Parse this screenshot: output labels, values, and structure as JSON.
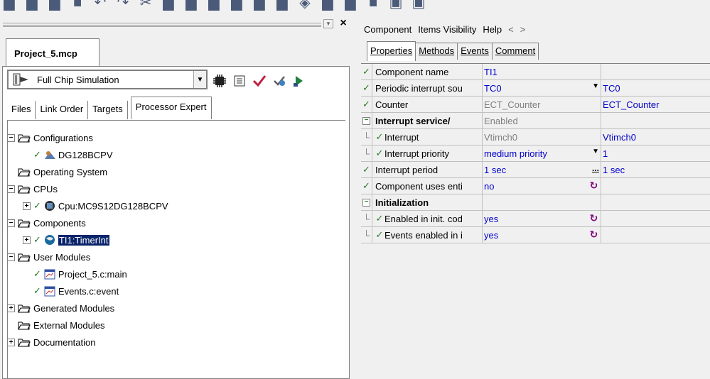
{
  "toolbar": {
    "icons": [
      "new-icon",
      "open-icon",
      "folder-icon",
      "save-icon",
      "undo-icon",
      "redo-icon",
      "cut-icon",
      "copy-icon",
      "paste-icon",
      "find-icon",
      "find-next-icon",
      "replace-icon",
      "window-icon",
      "debug-icon",
      "component-icon",
      "make-icon",
      "stop-icon",
      "window-list-icon",
      "properties-icon"
    ]
  },
  "project": {
    "tab_label": "Project_5.mcp",
    "target": "Full Chip Simulation",
    "sub_tabs": [
      "Files",
      "Link Order",
      "Targets",
      "Processor Expert"
    ],
    "active_sub_tab": "Processor Expert",
    "tree": [
      {
        "label": "Configurations",
        "level": 0,
        "expander": "−",
        "icon": "folder"
      },
      {
        "label": "DG128BCPV",
        "level": 1,
        "expander": "",
        "icon": "cpu-config",
        "check": true
      },
      {
        "label": "Operating System",
        "level": 0,
        "expander": "",
        "icon": "folder"
      },
      {
        "label": "CPUs",
        "level": 0,
        "expander": "−",
        "icon": "folder"
      },
      {
        "label": "Cpu:MC9S12DG128BCPV",
        "level": 1,
        "expander": "+",
        "icon": "chip",
        "check": true
      },
      {
        "label": "Components",
        "level": 0,
        "expander": "−",
        "icon": "folder"
      },
      {
        "label": "TI1:TimerInt",
        "level": 1,
        "expander": "+",
        "icon": "globe",
        "check": true,
        "selected": true
      },
      {
        "label": "User Modules",
        "level": 0,
        "expander": "−",
        "icon": "folder"
      },
      {
        "label": "Project_5.c:main",
        "level": 1,
        "expander": "",
        "icon": "module",
        "check": true
      },
      {
        "label": "Events.c:event",
        "level": 1,
        "expander": "",
        "icon": "module",
        "check": true
      },
      {
        "label": "Generated Modules",
        "level": 0,
        "expander": "+",
        "icon": "folder"
      },
      {
        "label": "External Modules",
        "level": 0,
        "expander": "",
        "icon": "folder"
      },
      {
        "label": "Documentation",
        "level": 0,
        "expander": "+",
        "icon": "folder"
      }
    ]
  },
  "inspector": {
    "menu": [
      "Component",
      "Items Visibility",
      "Help"
    ],
    "nav": [
      "<",
      ">"
    ],
    "tabs": [
      {
        "label": "Properties",
        "active": true
      },
      {
        "label": "Methods",
        "active": false
      },
      {
        "label": "Events",
        "active": false
      },
      {
        "label": "Comment",
        "active": false
      }
    ],
    "rows": [
      {
        "type": "item",
        "name": "Component name",
        "value": "TI1",
        "value_style": "blue",
        "extra": "",
        "control": ""
      },
      {
        "type": "item",
        "name": "Periodic interrupt sou",
        "value": "TC0",
        "value_style": "blue",
        "extra": "TC0",
        "control": "dropdown"
      },
      {
        "type": "item",
        "name": "Counter",
        "value": "ECT_Counter",
        "value_style": "grey",
        "extra": "ECT_Counter",
        "control": ""
      },
      {
        "type": "group",
        "name": "Interrupt service/",
        "value": "Enabled",
        "value_style": "grey",
        "extra": "",
        "control": ""
      },
      {
        "type": "sub",
        "name": "Interrupt",
        "value": "Vtimch0",
        "value_style": "grey",
        "extra": "Vtimch0",
        "control": ""
      },
      {
        "type": "sub",
        "name": "Interrupt priority",
        "value": "medium priority",
        "value_style": "blue",
        "extra": "1",
        "control": "dropdown"
      },
      {
        "type": "item",
        "name": "Interrupt period",
        "value": "1 sec",
        "value_style": "blue",
        "extra": "1 sec",
        "control": "ellipsis"
      },
      {
        "type": "item",
        "name": "Component uses enti",
        "value": "no",
        "value_style": "blue",
        "extra": "",
        "control": "toggle"
      },
      {
        "type": "group",
        "name": "Initialization",
        "value": "",
        "value_style": "",
        "extra": "",
        "control": ""
      },
      {
        "type": "sub",
        "name": "Enabled in init. cod",
        "value": "yes",
        "value_style": "blue",
        "extra": "",
        "control": "toggle"
      },
      {
        "type": "sub",
        "name": "Events enabled in i",
        "value": "yes",
        "value_style": "blue",
        "extra": "",
        "control": "toggle"
      }
    ]
  },
  "colors": {
    "selection": "#0a246a",
    "value_blue": "#0000cc",
    "check_green": "#2a7a2a"
  }
}
